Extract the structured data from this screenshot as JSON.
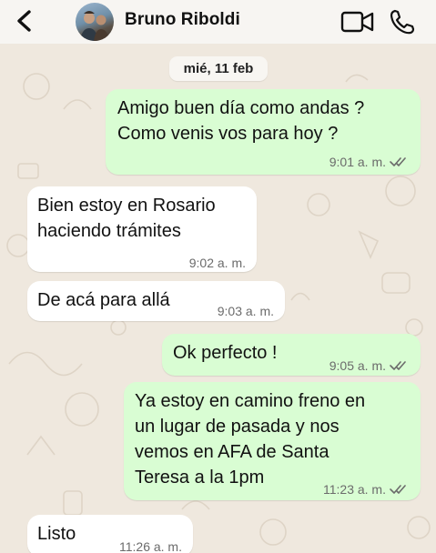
{
  "header": {
    "contact_name": "Bruno Riboldi",
    "back_icon": "chevron-left-icon",
    "video_icon": "video-camera-icon",
    "call_icon": "phone-icon"
  },
  "date_label": "mié, 11 feb",
  "messages": [
    {
      "direction": "out",
      "lines": [
        "Amigo buen día como andas ?",
        "Como venis vos para hoy ?"
      ],
      "time": "9:01 a. m.",
      "read": true
    },
    {
      "direction": "in",
      "lines": [
        "Bien estoy en Rosario",
        "haciendo trámites"
      ],
      "time": "9:02 a. m."
    },
    {
      "direction": "in",
      "lines": [
        "De acá para allá"
      ],
      "time": "9:03 a. m."
    },
    {
      "direction": "out",
      "lines": [
        "Ok perfecto !"
      ],
      "time": "9:05 a. m.",
      "read": true
    },
    {
      "direction": "out",
      "lines": [
        "Ya estoy en camino freno en",
        "un lugar de pasada y nos",
        "vemos en AFA de Santa",
        "Teresa a la 1pm"
      ],
      "time": "11:23 a. m.",
      "read": true
    },
    {
      "direction": "in",
      "lines": [
        "Listo"
      ],
      "time": "11:26 a. m."
    }
  ],
  "colors": {
    "outgoing_bubble": "#d9fdd3",
    "incoming_bubble": "#ffffff",
    "read_ticks": "#6b6b6b",
    "wallpaper": "#efe8de"
  }
}
